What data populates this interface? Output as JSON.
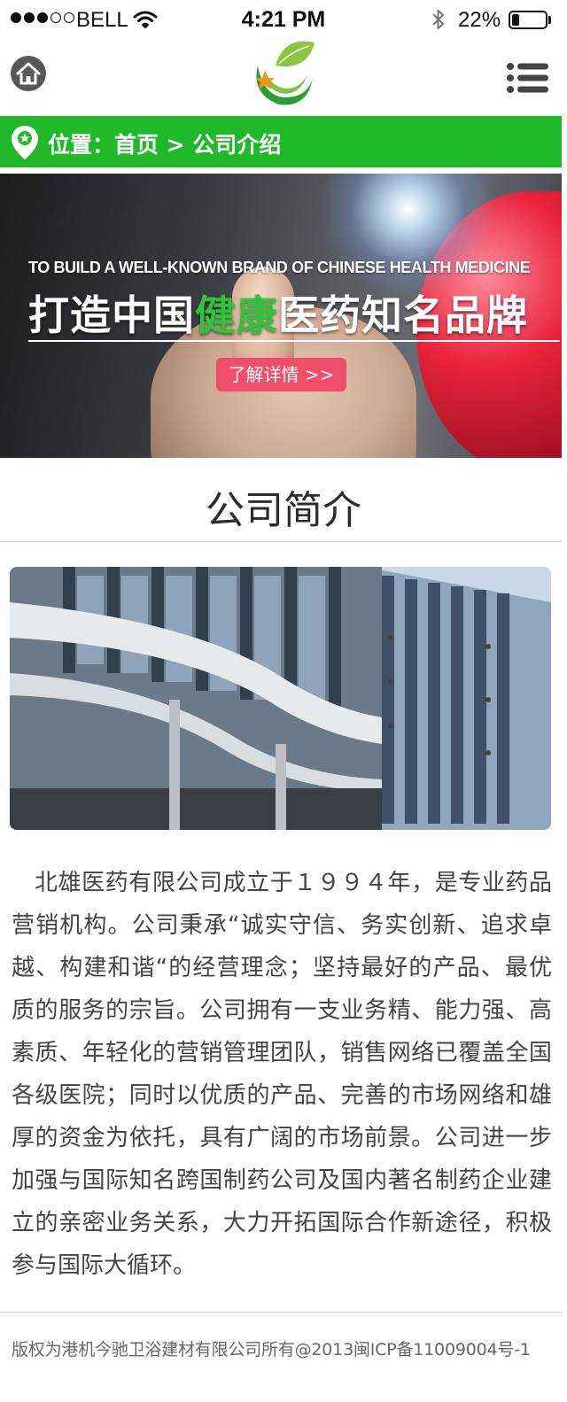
{
  "status_bar": {
    "carrier": "BELL",
    "time": "4:21 PM",
    "battery_percent": "22%",
    "battery_level": 0.22,
    "signal_bars": 3,
    "signal_bars_total": 5
  },
  "header": {
    "home_icon": "home-icon",
    "logo": "leaf-star-logo",
    "menu_icon": "menu-icon"
  },
  "breadcrumb": {
    "prefix": "位置：",
    "home": "首页",
    "separator": ">",
    "current": "公司介绍"
  },
  "banner": {
    "english_slogan": "TO BUILD A WELL-KNOWN BRAND OF CHINESE HEALTH MEDICINE",
    "slogan_part1": "打造中国",
    "slogan_highlight": "健康",
    "slogan_part2": "医药知名品牌",
    "button_label": "了解详情 >>"
  },
  "section": {
    "title": "公司简介"
  },
  "intro": {
    "text": "北雄医药有限公司成立于１９９４年，是专业药品营销机构。公司秉承“诚实守信、务实创新、追求卓越、构建和谐“的经营理念；坚持最好的产品、最优质的服务的宗旨。公司拥有一支业务精、能力强、高素质、年轻化的营销管理团队，销售网络已覆盖全国各级医院；同时以优质的产品、完善的市场网络和雄厚的资金为依托，具有广阔的市场前景。公司进一步加强与国际知名跨国制药公司及国内著名制药企业建立的亲密业务关系，大力开拓国际合作新途径，积极参与国际大循环。"
  },
  "footer": {
    "copyright": "版权为港机今驰卫浴建材有限公司所有@2013闽ICP备11009004号-1"
  },
  "colors": {
    "brand_green": "#1fb92a",
    "button_pink": "#ef4d6a",
    "highlight_green": "#2fc43a"
  }
}
